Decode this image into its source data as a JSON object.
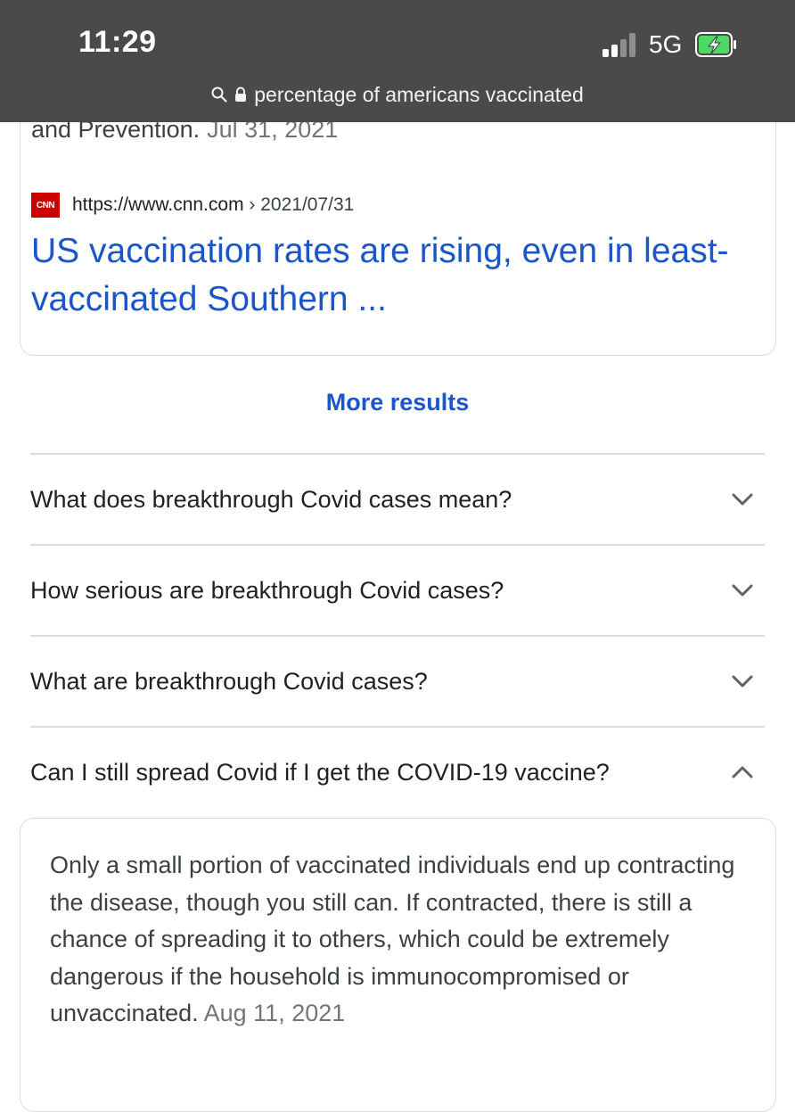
{
  "status_bar": {
    "time": "11:29",
    "network": "5G",
    "signal_bars_active": 2,
    "battery_state": "charging",
    "battery_color": "#4cd964"
  },
  "url_bar": {
    "query": "percentage of americans vaccinated",
    "search_icon": "search-icon",
    "lock_icon": "lock-icon"
  },
  "result": {
    "snippet_tail": "and Prevention.",
    "snippet_date": "Jul 31, 2021",
    "favicon_text": "CNN",
    "favicon_color": "#cc0000",
    "url_domain": "https://www.cnn.com",
    "url_path": "› 2021/07/31",
    "title": "US vaccination rates are rising, even in least-vaccinated Southern ..."
  },
  "more_results_label": "More results",
  "questions": [
    {
      "text": "What does breakthrough Covid cases mean?",
      "expanded": false
    },
    {
      "text": "How serious are breakthrough Covid cases?",
      "expanded": false
    },
    {
      "text": "What are breakthrough Covid cases?",
      "expanded": false
    },
    {
      "text": "Can I still spread Covid if I get the COVID-19 vaccine?",
      "expanded": true
    }
  ],
  "answer": {
    "text": "Only a small portion of vaccinated individuals end up contracting the disease, though you still can. If contracted, there is still a chance of spreading it to others, which could be extremely dangerous if the household is immunocompromised or unvaccinated.",
    "date": "Aug 11, 2021"
  },
  "colors": {
    "link_blue": "#1a55c9",
    "divider": "#dadce0",
    "top_bar": "#4a4a4a"
  }
}
